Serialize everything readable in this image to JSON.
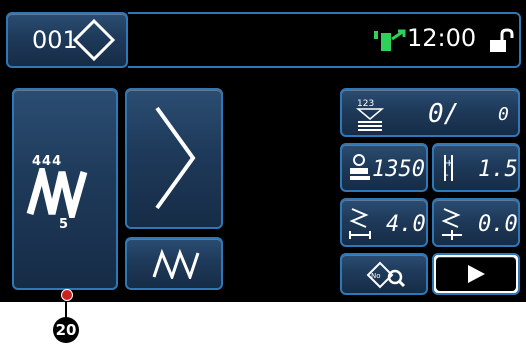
{
  "header": {
    "pattern_number": "001",
    "time": "12:00"
  },
  "info_panel": {
    "counter_value": "0/",
    "counter_total": "0",
    "speed": "1350",
    "pitch": "1.5",
    "zigzag_width": "4.0",
    "zigzag_base": "0.0"
  },
  "pattern_thumb": {
    "number_label": "444",
    "sub_label": "5"
  },
  "callout": {
    "number": "20"
  },
  "icons": [
    "pattern-number-icon",
    "bobbin-winder-icon",
    "unlock-icon",
    "bobbin-counter-icon",
    "presser-foot-speed-icon",
    "stitch-pitch-icon",
    "zigzag-width-icon",
    "zigzag-base-icon",
    "pattern-search-icon",
    "play-icon"
  ]
}
